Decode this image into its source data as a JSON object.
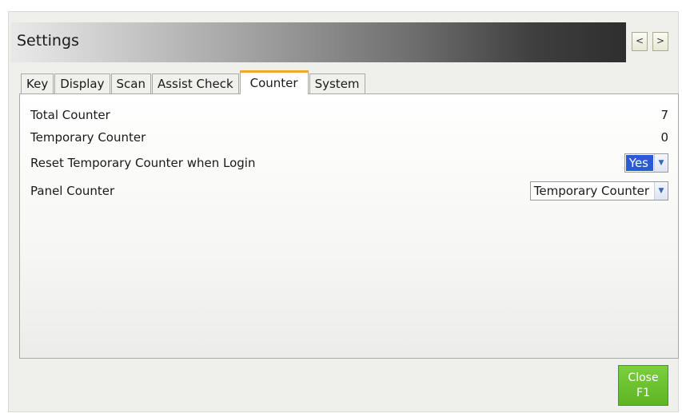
{
  "window": {
    "title": "Settings",
    "nav_prev": "<",
    "nav_next": ">"
  },
  "tabs": [
    {
      "label": "Key"
    },
    {
      "label": "Display"
    },
    {
      "label": "Scan"
    },
    {
      "label": "Assist Check"
    },
    {
      "label": "Counter",
      "active": true
    },
    {
      "label": "System"
    }
  ],
  "counter": {
    "total": {
      "label": "Total Counter",
      "value": "7"
    },
    "temporary": {
      "label": "Temporary Counter",
      "value": "0"
    },
    "reset_on_login": {
      "label": "Reset Temporary Counter when Login",
      "value": "Yes"
    },
    "panel_counter": {
      "label": "Panel Counter",
      "value": "Temporary Counter"
    }
  },
  "footer": {
    "close_label": "Close",
    "close_key": "F1"
  },
  "colors": {
    "active_tab_accent": "#f0a830",
    "close_button": "#6cc22f",
    "selection_highlight": "#2a5bd7"
  }
}
